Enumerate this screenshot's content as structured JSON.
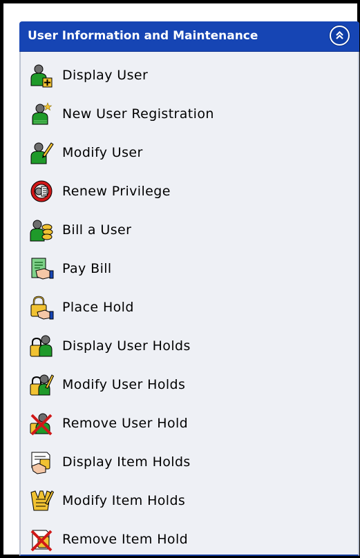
{
  "panel": {
    "title": "User Information and Maintenance",
    "collapse_icon": "double-chevron-up-icon"
  },
  "menu": {
    "items": [
      {
        "label": "Display User",
        "icon": "display-user-icon"
      },
      {
        "label": "New User Registration",
        "icon": "new-user-registration-icon"
      },
      {
        "label": "Modify User",
        "icon": "modify-user-icon"
      },
      {
        "label": "Renew Privilege",
        "icon": "renew-privilege-icon"
      },
      {
        "label": "Bill a User",
        "icon": "bill-user-icon"
      },
      {
        "label": "Pay Bill",
        "icon": "pay-bill-icon"
      },
      {
        "label": "Place Hold",
        "icon": "place-hold-icon"
      },
      {
        "label": "Display User Holds",
        "icon": "display-user-holds-icon"
      },
      {
        "label": "Modify User Holds",
        "icon": "modify-user-holds-icon"
      },
      {
        "label": "Remove User Hold",
        "icon": "remove-user-hold-icon"
      },
      {
        "label": "Display Item Holds",
        "icon": "display-item-holds-icon"
      },
      {
        "label": "Modify Item Holds",
        "icon": "modify-item-holds-icon"
      },
      {
        "label": "Remove Item Hold",
        "icon": "remove-item-hold-icon"
      }
    ]
  },
  "colors": {
    "header_blue": "#1645b4",
    "panel_background": "#eef0f5",
    "user_green": "#1f9a2a",
    "hold_yellow": "#f1c232",
    "remove_red": "#d01818"
  }
}
